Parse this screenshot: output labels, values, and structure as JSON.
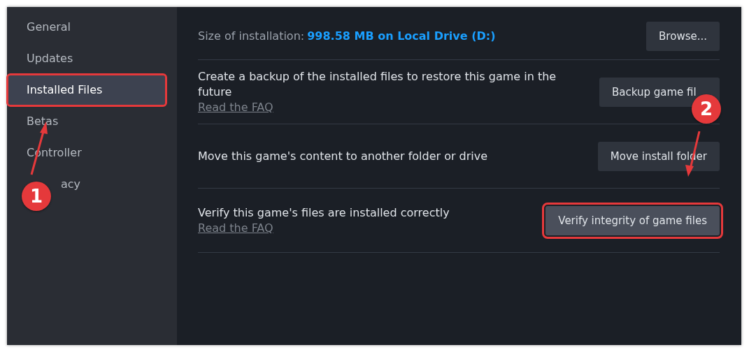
{
  "sidebar": {
    "items": [
      {
        "label": "General",
        "selected": false,
        "highlighted": false
      },
      {
        "label": "Updates",
        "selected": false,
        "highlighted": false
      },
      {
        "label": "Installed Files",
        "selected": true,
        "highlighted": true
      },
      {
        "label": "Betas",
        "selected": false,
        "highlighted": false
      },
      {
        "label": "Controller",
        "selected": false,
        "highlighted": false
      },
      {
        "label": "acy",
        "selected": false,
        "highlighted": false
      }
    ]
  },
  "size": {
    "label": "Size of installation:",
    "value": "998.58 MB on Local Drive (D:)",
    "button": "Browse..."
  },
  "rows": [
    {
      "description": "Create a backup of the installed files to restore this game in the future",
      "link": "Read the FAQ",
      "button": {
        "label": "Backup game fil",
        "highlighted": false
      }
    },
    {
      "description": "Move this game's content to another folder or drive",
      "button": {
        "label": "Move install folder",
        "highlighted": false
      }
    },
    {
      "description": "Verify this game's files are installed correctly",
      "link": "Read the FAQ",
      "button": {
        "label": "Verify integrity of game files",
        "highlighted": true
      }
    }
  ],
  "annotations": [
    {
      "label": "1"
    },
    {
      "label": "2"
    }
  ]
}
